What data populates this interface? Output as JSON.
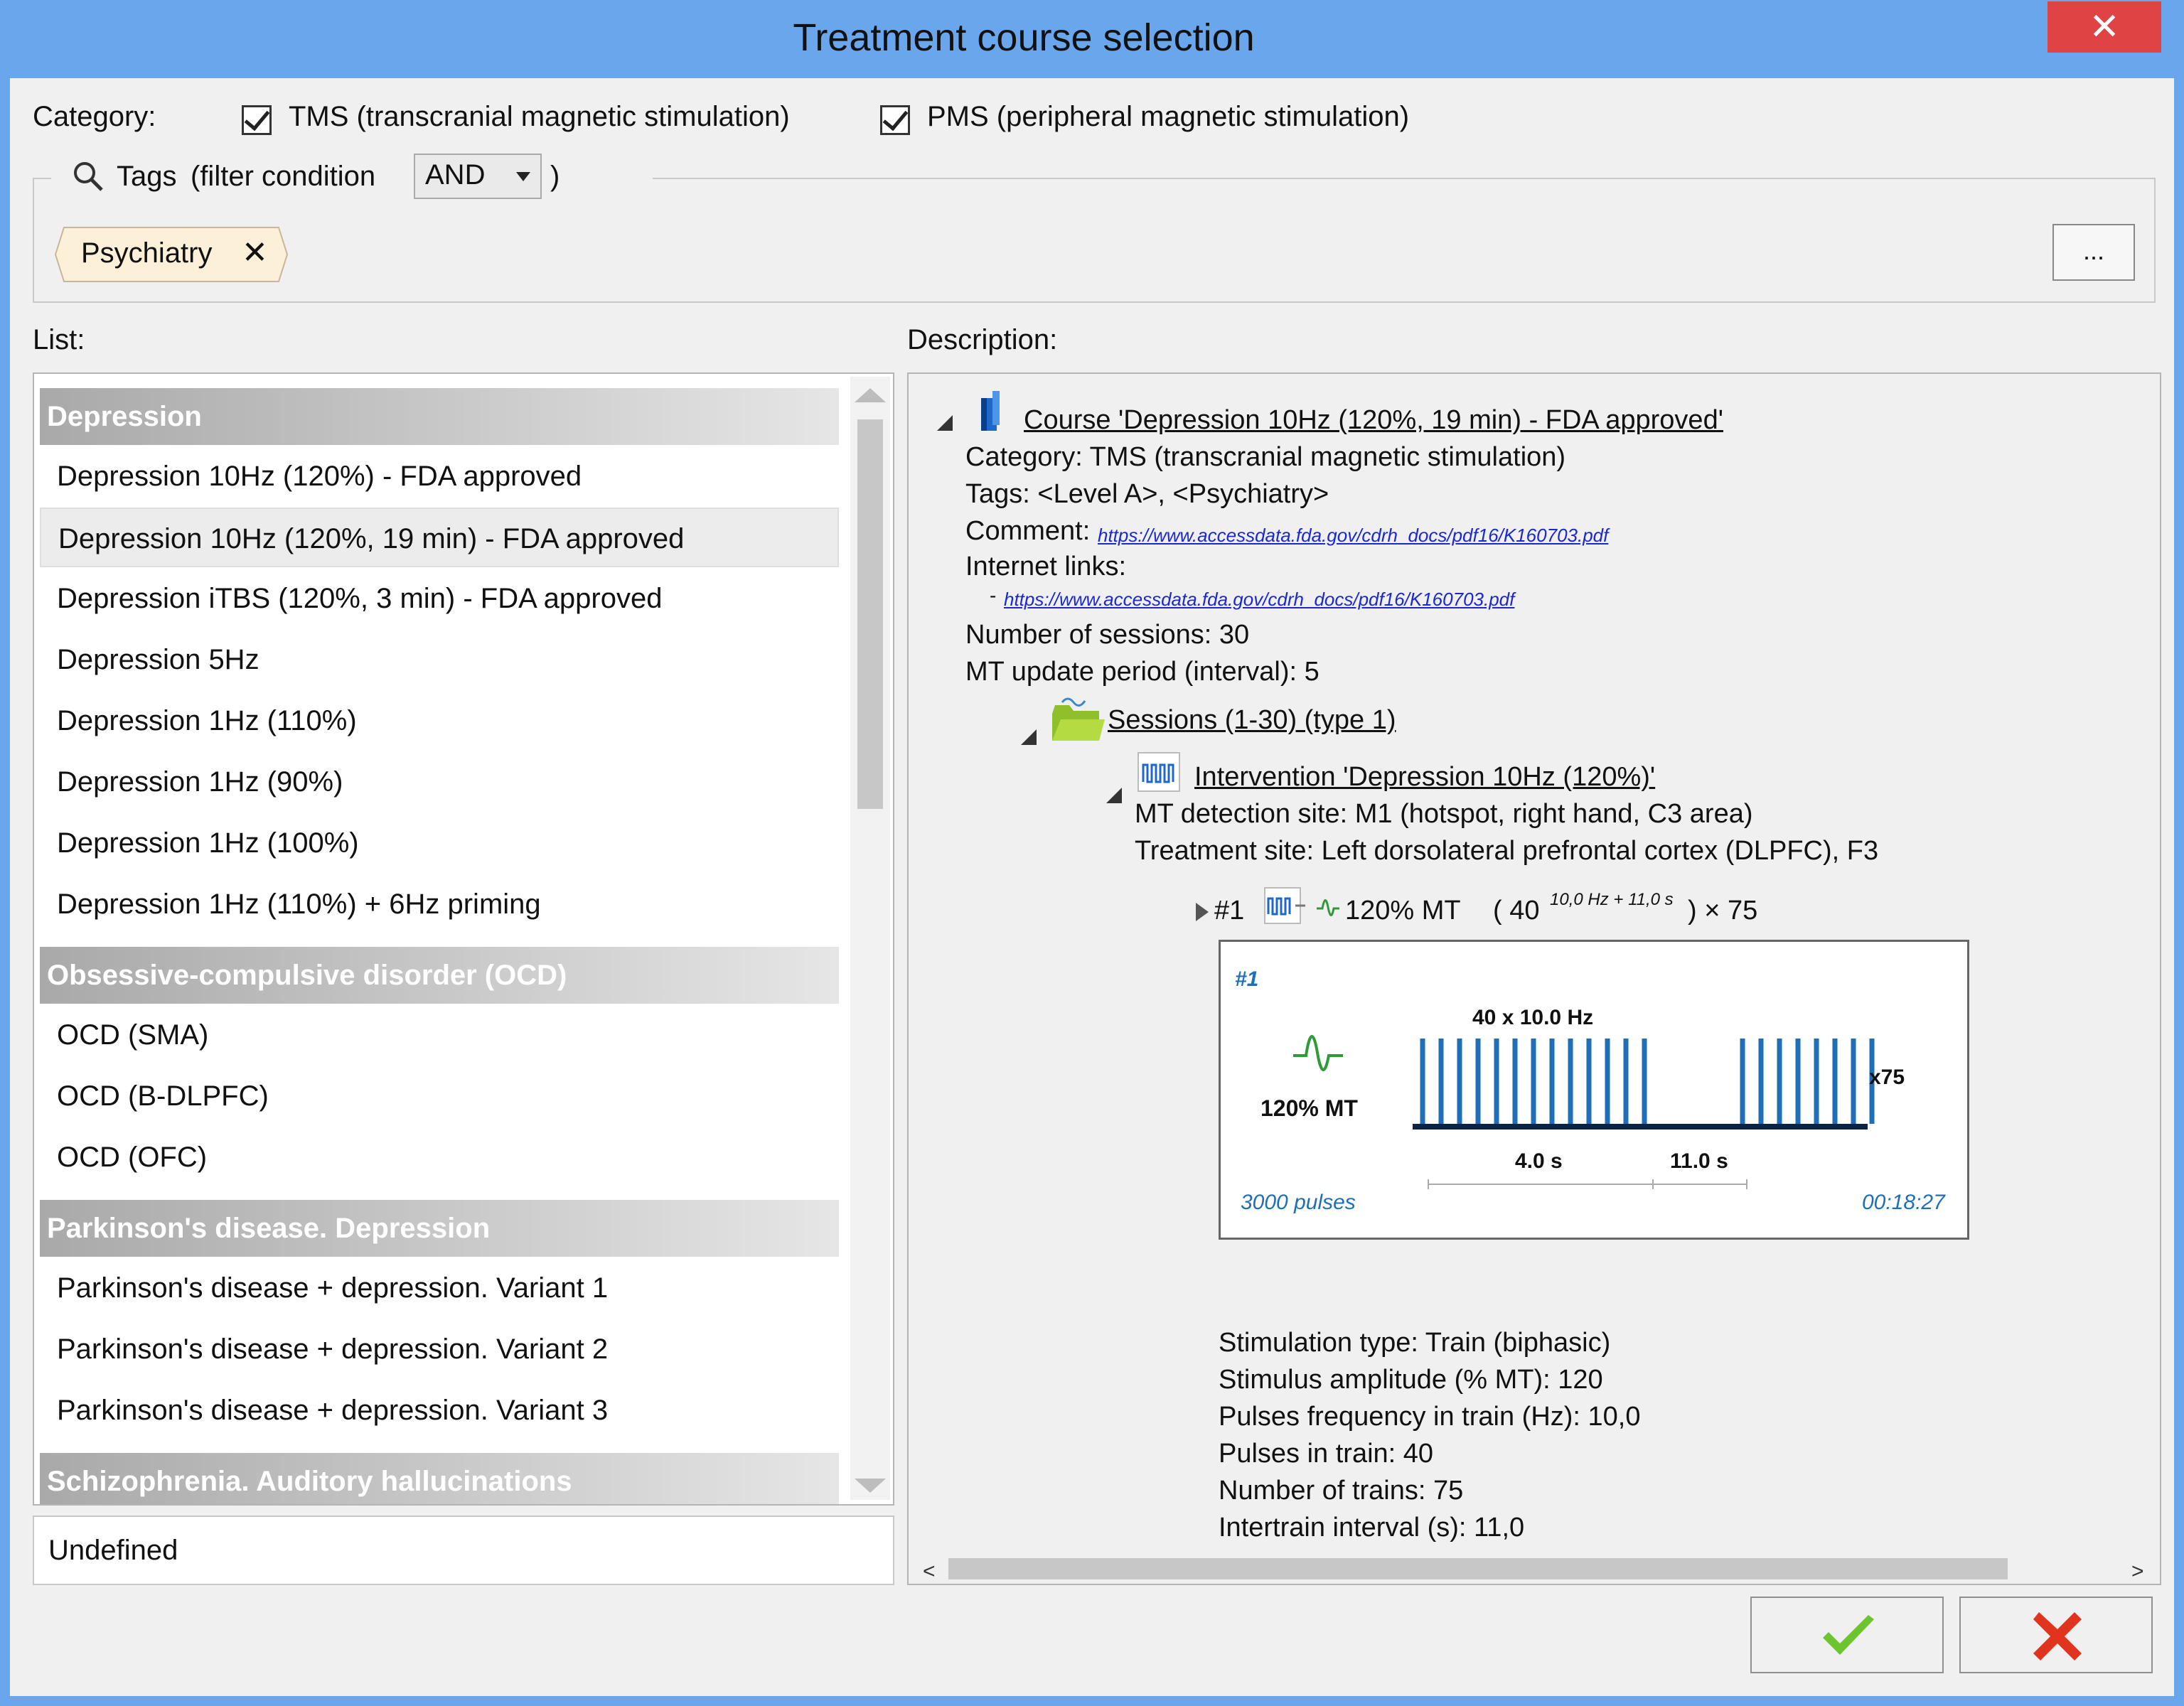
{
  "window": {
    "title": "Treatment course selection",
    "close_glyph": "✕"
  },
  "category": {
    "label": "Category:",
    "options": [
      {
        "label": "TMS (transcranial magnetic stimulation)",
        "checked": true
      },
      {
        "label": "PMS (peripheral magnetic stimulation)",
        "checked": true
      }
    ]
  },
  "tags": {
    "label_prefix": "Tags",
    "label_filter": "(filter condition",
    "label_close": ")",
    "condition": "AND",
    "chips": [
      {
        "label": "Psychiatry",
        "remove_glyph": "✕"
      }
    ],
    "more_button": "..."
  },
  "list": {
    "label": "List:",
    "groups": [
      {
        "name": "Depression",
        "items": [
          "Depression 10Hz (120%) - FDA approved",
          "Depression 10Hz (120%, 19 min) - FDA approved",
          "Depression iTBS (120%, 3 min) - FDA approved",
          "Depression 5Hz",
          "Depression 1Hz (110%)",
          "Depression 1Hz (90%)",
          "Depression 1Hz (100%)",
          "Depression 1Hz (110%) + 6Hz priming"
        ]
      },
      {
        "name": "Obsessive-compulsive disorder (OCD)",
        "items": [
          "OCD (SMA)",
          "OCD (B-DLPFC)",
          "OCD (OFC)"
        ]
      },
      {
        "name": "Parkinson's disease. Depression",
        "items": [
          "Parkinson's disease + depression. Variant 1",
          "Parkinson's disease + depression. Variant 2",
          "Parkinson's disease + depression. Variant 3"
        ]
      },
      {
        "name": "Schizophrenia. Auditory hallucinations",
        "items": []
      }
    ],
    "selected_index": 1,
    "undefined_label": "Undefined"
  },
  "description": {
    "label": "Description:",
    "course": {
      "title": "Course 'Depression 10Hz (120%, 19 min) - FDA approved'",
      "category": "Category: TMS (transcranial magnetic stimulation)",
      "tags": "Tags: <Level A>, <Psychiatry>",
      "comment_label": "Comment:",
      "comment_link": "https://www.accessdata.fda.gov/cdrh_docs/pdf16/K160703.pdf",
      "internet_links_label": "Internet links:",
      "internet_link_bullet": "-",
      "internet_link": "https://www.accessdata.fda.gov/cdrh_docs/pdf16/K160703.pdf",
      "sessions_count": "Number of sessions: 30",
      "mt_update": "MT update period (interval): 5"
    },
    "sessions": {
      "title": "Sessions (1-30) (type 1)"
    },
    "intervention": {
      "title": "Intervention 'Depression 10Hz (120%)'",
      "mt_site": "MT detection site: M1 (hotspot, right hand, C3 area)",
      "treatment_site": "Treatment site: Left dorsolateral prefrontal cortex (DLPFC), F3"
    },
    "protocol": {
      "index": "#1",
      "intensity": "120% MT",
      "formula_open": "( 40",
      "formula_sup": "10,0 Hz + 11,0 s",
      "formula_close": ") × 75"
    },
    "preview": {
      "index": "#1",
      "intensity": "120% MT",
      "train_label": "40 x 10.0 Hz",
      "repeat": "x75",
      "train_duration": "4.0 s",
      "interval": "11.0 s",
      "pulses": "3000 pulses",
      "duration": "00:18:27",
      "accent": "#1f6fb8",
      "wave_color": "#2e9a3a"
    },
    "params": [
      "Stimulation type: Train (biphasic)",
      "Stimulus amplitude (% MT): 120",
      "Pulses frequency in train (Hz): 10,0",
      "Pulses in train: 40",
      "Number of trains: 75",
      "Intertrain interval (s): 11,0"
    ]
  },
  "buttons": {
    "ok_icon": "check-icon",
    "cancel_icon": "cross-icon",
    "ok_color": "#6cc52e",
    "cancel_color": "#e0341f"
  }
}
